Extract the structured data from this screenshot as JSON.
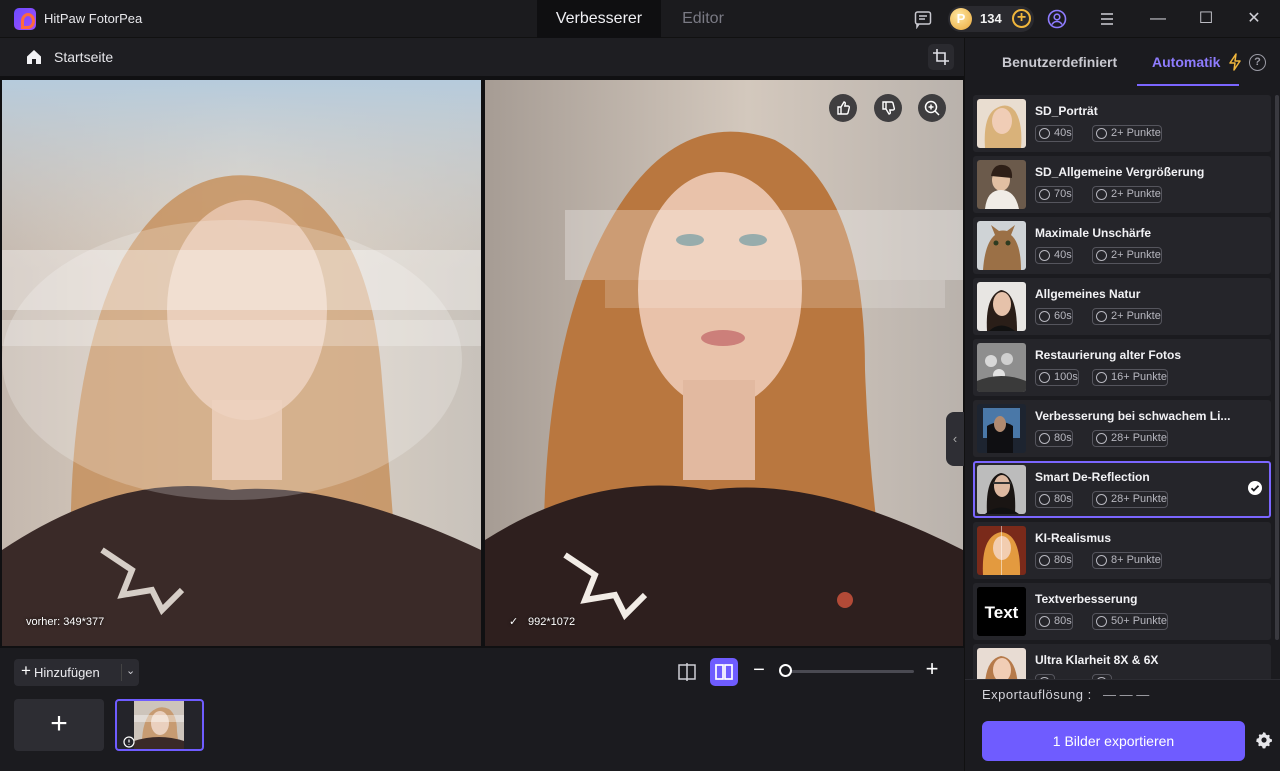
{
  "app": {
    "name": "HitPaw FotorPea"
  },
  "top_tabs": {
    "enhancer": "Verbesserer",
    "editor": "Editor"
  },
  "coins": {
    "value": "134"
  },
  "window": {
    "minimize": "—",
    "maximize": "☐",
    "close": "✕"
  },
  "breadcrumb": {
    "home_label": "Startseite"
  },
  "canvas": {
    "before_label": "vorher: 349*377",
    "after_label": "992*1072",
    "collapse_glyph": "‹"
  },
  "bottom": {
    "add_label": "Hinzufügen",
    "add_plus": "+",
    "add_caret": "⌄",
    "zoom_minus": "−",
    "zoom_plus": "+",
    "thumb_add": "+"
  },
  "panel": {
    "tab_custom": "Benutzerdefiniert",
    "tab_auto": "Automatik",
    "help": "?",
    "models": [
      {
        "name": "SD_Porträt",
        "time": "40s",
        "points": "2+ Punkte"
      },
      {
        "name": "SD_Allgemeine Vergrößerung",
        "time": "70s",
        "points": "2+ Punkte"
      },
      {
        "name": "Maximale Unschärfe",
        "time": "40s",
        "points": "2+ Punkte"
      },
      {
        "name": "Allgemeines Natur",
        "time": "60s",
        "points": "2+ Punkte"
      },
      {
        "name": "Restaurierung alter Fotos",
        "time": "100s",
        "points": "16+ Punkte"
      },
      {
        "name": "Verbesserung bei schwachem Li...",
        "time": "80s",
        "points": "28+ Punkte"
      },
      {
        "name": "Smart De-Reflection",
        "time": "80s",
        "points": "28+ Punkte",
        "selected": true
      },
      {
        "name": "KI-Realismus",
        "time": "80s",
        "points": "8+ Punkte"
      },
      {
        "name": "Textverbesserung",
        "time": "80s",
        "points": "50+ Punkte",
        "thumb_text": "Text"
      },
      {
        "name": "Ultra Klarheit 8X & 6X",
        "time": "",
        "points": ""
      }
    ],
    "export_res_label": "Exportauflösung :",
    "export_res_value": "— — —",
    "export_button": "1 Bilder exportieren"
  },
  "colors": {
    "accent": "#6f5cff",
    "coin": "#e9a83a",
    "bg": "#17171a"
  }
}
